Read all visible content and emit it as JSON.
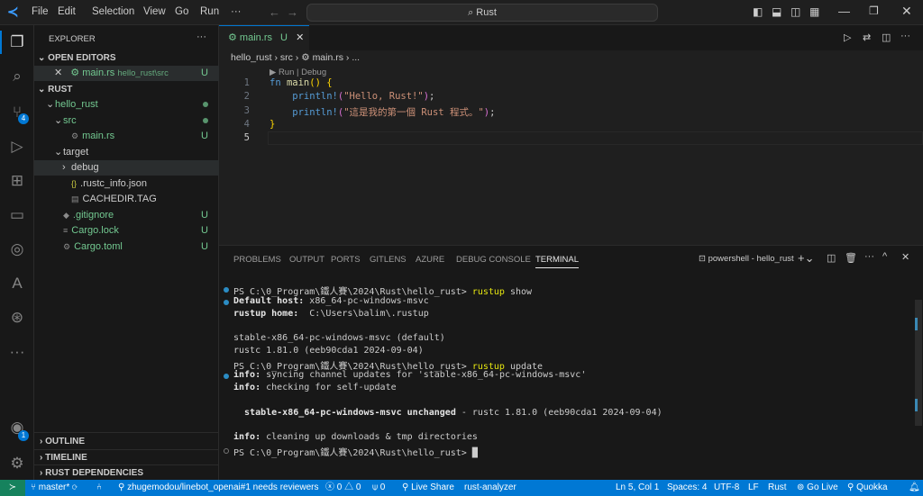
{
  "titlebar": {
    "menus": [
      "File",
      "Edit",
      "Selection",
      "View",
      "Go",
      "Run",
      "···"
    ],
    "search": "Rust"
  },
  "activity": {
    "scm_badge": "4",
    "account_badge": "1"
  },
  "sidebar": {
    "title": "EXPLORER",
    "more": "···",
    "open_editors": "OPEN EDITORS",
    "open_file": "main.rs",
    "open_file_path": "hello_rust\\src",
    "open_file_status": "U",
    "root": "RUST",
    "tree": [
      {
        "label": "hello_rust",
        "indent": 1,
        "twisty": "⌄",
        "icon": "",
        "cls": "green",
        "status": "dot"
      },
      {
        "label": "src",
        "indent": 2,
        "twisty": "⌄",
        "icon": "",
        "cls": "green",
        "status": "dot"
      },
      {
        "label": "main.rs",
        "indent": 3,
        "twisty": "",
        "icon": "⚙",
        "cls": "green",
        "status": "U"
      },
      {
        "label": "target",
        "indent": 2,
        "twisty": "⌄",
        "icon": "",
        "cls": "",
        "status": ""
      },
      {
        "label": "debug",
        "indent": 3,
        "twisty": "›",
        "icon": "",
        "cls": "",
        "status": ""
      },
      {
        "label": ".rustc_info.json",
        "indent": 3,
        "twisty": "",
        "icon": "{}",
        "cls": "",
        "status": ""
      },
      {
        "label": "CACHEDIR.TAG",
        "indent": 3,
        "twisty": "",
        "icon": "▤",
        "cls": "",
        "status": ""
      },
      {
        "label": ".gitignore",
        "indent": 2,
        "twisty": "",
        "icon": "◆",
        "cls": "green",
        "status": "U"
      },
      {
        "label": "Cargo.lock",
        "indent": 2,
        "twisty": "",
        "icon": "≡",
        "cls": "green",
        "status": "U"
      },
      {
        "label": "Cargo.toml",
        "indent": 2,
        "twisty": "",
        "icon": "⚙",
        "cls": "green",
        "status": "U"
      }
    ],
    "bottom_sections": [
      "OUTLINE",
      "TIMELINE",
      "RUST DEPENDENCIES"
    ]
  },
  "editor": {
    "tab": "main.rs",
    "tab_status": "U",
    "breadcrumb": [
      "hello_rust",
      "src",
      "main.rs",
      "..."
    ],
    "codelens": "▶ Run | Debug",
    "lines": [
      [
        {
          "t": "fn ",
          "c": "#569cd6"
        },
        {
          "t": "main",
          "c": "#dcdcaa"
        },
        {
          "t": "() ",
          "c": "#ffd700"
        },
        {
          "t": "{",
          "c": "#ffd700"
        }
      ],
      [
        {
          "t": "    println!",
          "c": "#569cd6"
        },
        {
          "t": "(",
          "c": "#da70d6"
        },
        {
          "t": "\"Hello, Rust!\"",
          "c": "#ce9178"
        },
        {
          "t": ")",
          "c": "#da70d6"
        },
        {
          "t": ";",
          "c": "#ccc"
        }
      ],
      [
        {
          "t": "    println!",
          "c": "#569cd6"
        },
        {
          "t": "(",
          "c": "#da70d6"
        },
        {
          "t": "\"這是我的第一個 Rust 程式。\"",
          "c": "#ce9178"
        },
        {
          "t": ")",
          "c": "#da70d6"
        },
        {
          "t": ";",
          "c": "#ccc"
        }
      ],
      [
        {
          "t": "}",
          "c": "#ffd700"
        }
      ],
      []
    ]
  },
  "panel": {
    "tabs": [
      "PROBLEMS",
      "OUTPUT",
      "PORTS",
      "GITLENS",
      "AZURE",
      "DEBUG CONSOLE",
      "TERMINAL"
    ],
    "active": "TERMINAL",
    "terminal_name": "powershell - hello_rust",
    "terminal": [
      {
        "dot": "blue",
        "parts": [
          {
            "t": "PS C:\\0_Program\\鐵人賽\\2024\\Rust\\hello_rust> "
          },
          {
            "t": "rustup",
            "c": "#e5e510"
          },
          {
            "t": " show"
          }
        ]
      },
      {
        "dot": "blue",
        "parts": [
          {
            "t": "Default host:",
            "b": true
          },
          {
            "t": " x86_64-pc-windows-msvc"
          }
        ]
      },
      {
        "parts": [
          {
            "t": "rustup home:",
            "b": true
          },
          {
            "t": "  C:\\Users\\balim\\.rustup"
          }
        ]
      },
      {
        "parts": []
      },
      {
        "parts": [
          {
            "t": "stable-x86_64-pc-windows-msvc (default)"
          }
        ]
      },
      {
        "parts": [
          {
            "t": "rustc 1.81.0 (eeb90cda1 2024-09-04)"
          }
        ]
      },
      {
        "parts": [
          {
            "t": "PS C:\\0_Program\\鐵人賽\\2024\\Rust\\hello_rust> "
          },
          {
            "t": "rustup",
            "c": "#e5e510"
          },
          {
            "t": " update"
          }
        ]
      },
      {
        "dot": "blue",
        "parts": [
          {
            "t": "info:",
            "b": true
          },
          {
            "t": " syncing channel updates for 'stable-x86_64-pc-windows-msvc'"
          }
        ]
      },
      {
        "parts": [
          {
            "t": "info:",
            "b": true
          },
          {
            "t": " checking for self-update"
          }
        ]
      },
      {
        "parts": []
      },
      {
        "parts": [
          {
            "t": "  stable-x86_64-pc-windows-msvc unchanged",
            "b": true
          },
          {
            "t": " - rustc 1.81.0 (eeb90cda1 2024-09-04)"
          }
        ]
      },
      {
        "parts": []
      },
      {
        "parts": [
          {
            "t": "info:",
            "b": true
          },
          {
            "t": " cleaning up downloads & tmp directories"
          }
        ]
      },
      {
        "dot": "hollow",
        "parts": [
          {
            "t": "PS C:\\0_Program\\鐵人賽\\2024\\Rust\\hello_rust> "
          },
          {
            "t": "█",
            "c": "#ccc"
          }
        ]
      }
    ]
  },
  "status": {
    "branch": "master*",
    "pr": "zhugemodou/linebot_openai#1 needs reviewers",
    "errors": "0",
    "warnings": "0",
    "ports": "0",
    "liveshare": "Live Share",
    "analyzer": "rust-analyzer",
    "right": [
      "Ln 5, Col 1",
      "Spaces: 4",
      "UTF-8",
      "LF",
      "Rust",
      "Go Live",
      "Quokka"
    ]
  },
  "colors": {
    "accent": "#0078d4",
    "git_untracked": "#73c991"
  }
}
